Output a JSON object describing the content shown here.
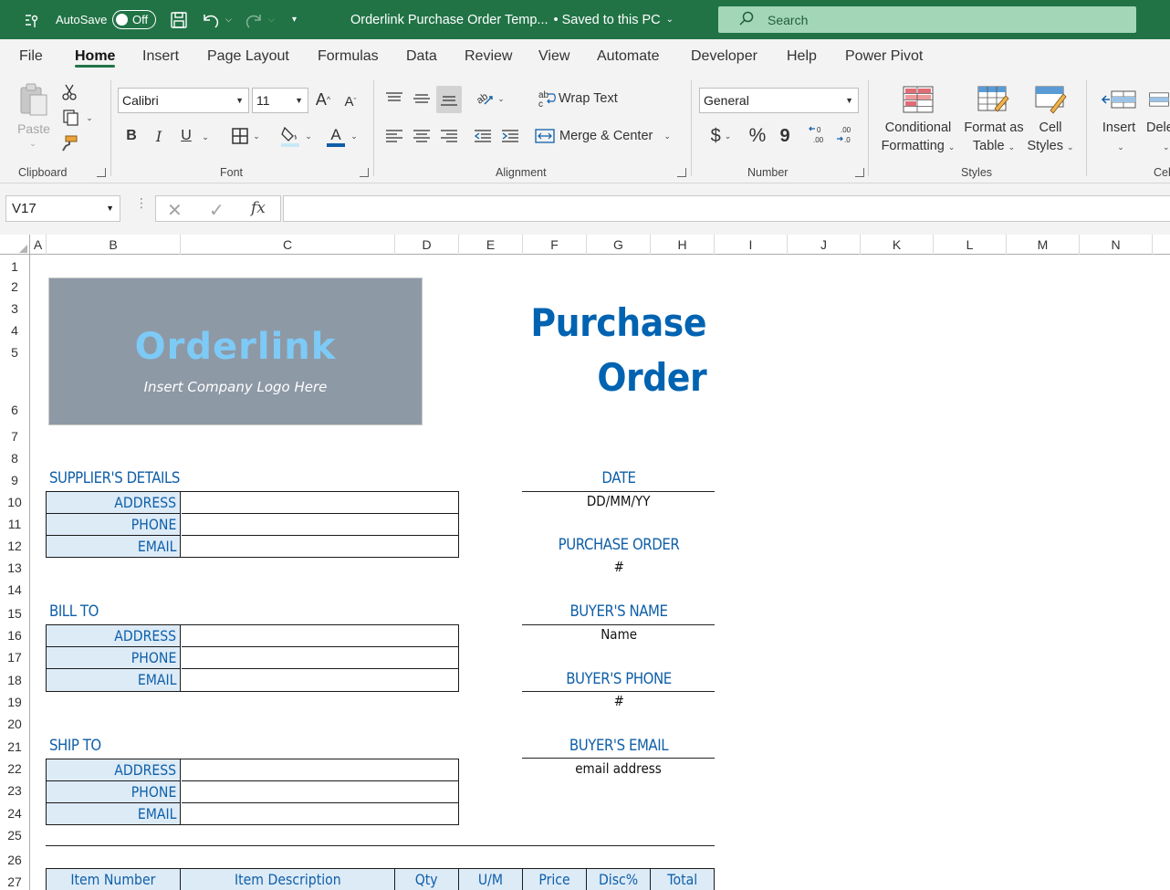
{
  "titlebar": {
    "autosave_label": "AutoSave",
    "autosave_state": "Off",
    "document_title": "Orderlink Purchase Order Temp...",
    "save_status": "• Saved to this PC",
    "search_placeholder": "Search"
  },
  "menu": {
    "tabs": [
      "File",
      "Home",
      "Insert",
      "Page Layout",
      "Formulas",
      "Data",
      "Review",
      "View",
      "Automate",
      "Developer",
      "Help",
      "Power Pivot"
    ],
    "active": "Home"
  },
  "ribbon": {
    "clipboard": {
      "label": "Clipboard",
      "paste": "Paste"
    },
    "font": {
      "label": "Font",
      "name": "Calibri",
      "size": "11",
      "bold": "B",
      "italic": "I",
      "underline": "U"
    },
    "alignment": {
      "label": "Alignment",
      "wrap_text": "Wrap Text",
      "merge_center": "Merge & Center"
    },
    "number": {
      "label": "Number",
      "format": "General",
      "currency": "$",
      "percent": "%",
      "comma": "9"
    },
    "styles": {
      "label": "Styles",
      "conditional_line1": "Conditional",
      "conditional_line2": "Formatting",
      "format_table_line1": "Format as",
      "format_table_line2": "Table",
      "cell_styles_line1": "Cell",
      "cell_styles_line2": "Styles"
    },
    "cells": {
      "label": "Cel",
      "insert": "Insert",
      "delete": "Dele"
    }
  },
  "formula_bar": {
    "name_box": "V17",
    "fx": "fx",
    "value": ""
  },
  "grid": {
    "columns": [
      "A",
      "B",
      "C",
      "D",
      "E",
      "F",
      "G",
      "H",
      "I",
      "J",
      "K",
      "L",
      "M",
      "N"
    ],
    "rows": [
      "1",
      "2",
      "3",
      "4",
      "5",
      "6",
      "7",
      "8",
      "9",
      "10",
      "11",
      "12",
      "13",
      "14",
      "15",
      "16",
      "17",
      "18",
      "19",
      "20",
      "21",
      "22",
      "23",
      "24",
      "25",
      "26",
      "27"
    ]
  },
  "sheet": {
    "logo": {
      "name": "Orderlink",
      "caption": "Insert Company Logo Here"
    },
    "title_line1": "Purchase",
    "title_line2": "Order",
    "supplier": {
      "heading": "SUPPLIER'S DETAILS",
      "fields": [
        "ADDRESS",
        "PHONE",
        "EMAIL"
      ]
    },
    "bill_to": {
      "heading": "BILL TO",
      "fields": [
        "ADDRESS",
        "PHONE",
        "EMAIL"
      ]
    },
    "ship_to": {
      "heading": "SHIP TO",
      "fields": [
        "ADDRESS",
        "PHONE",
        "EMAIL"
      ]
    },
    "right_panel": [
      {
        "label": "DATE",
        "value": "DD/MM/YY"
      },
      {
        "label": "PURCHASE ORDER",
        "value": "#"
      },
      {
        "label": "BUYER'S NAME",
        "value": "Name"
      },
      {
        "label": "BUYER'S PHONE",
        "value": "#"
      },
      {
        "label": "BUYER'S EMAIL",
        "value": "email address"
      }
    ],
    "table_headers": [
      "Item Number",
      "Item Description",
      "Qty",
      "U/M",
      "Price",
      "Disc%",
      "Total"
    ]
  },
  "colors": {
    "excel_green": "#217346",
    "heading_blue": "#0f5fa8",
    "label_fill": "#ddebf7",
    "logo_fill": "#8e99a6"
  }
}
